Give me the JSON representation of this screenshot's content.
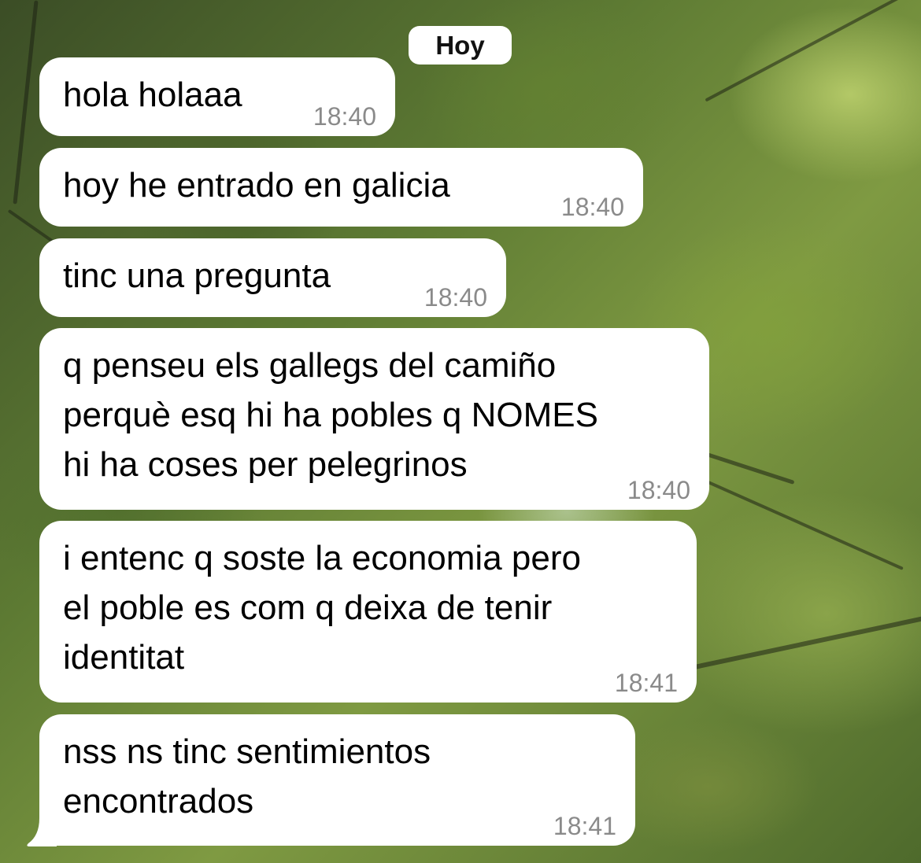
{
  "date_separator": "Hoy",
  "messages": [
    {
      "text": "hola holaaa",
      "time": "18:40"
    },
    {
      "text": "hoy he entrado en galicia",
      "time": "18:40"
    },
    {
      "text": "tinc una pregunta",
      "time": "18:40"
    },
    {
      "text": "q penseu els gallegs del camiño\nperquè esq hi ha pobles q NOMES\nhi ha coses per pelegrinos",
      "time": "18:40"
    },
    {
      "text": "i entenc q soste la economia pero\nel poble es com q deixa de tenir\nidentitat",
      "time": "18:41"
    },
    {
      "text": "nss ns tinc sentimientos\nencontrados",
      "time": "18:41"
    }
  ],
  "colors": {
    "bubble": "#ffffff",
    "timestamp": "#8a8a8a"
  }
}
